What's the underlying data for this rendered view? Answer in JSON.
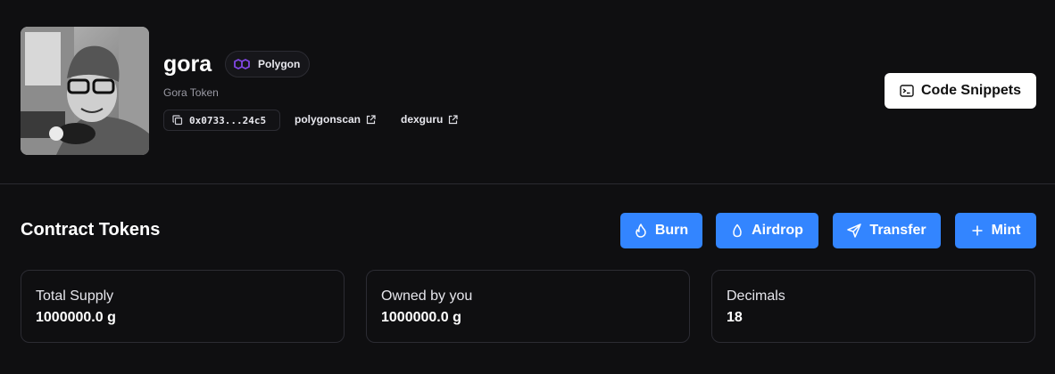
{
  "token": {
    "name": "gora",
    "subtitle": "Gora Token",
    "chain": "Polygon",
    "address_short": "0x0733...24c5",
    "links": [
      {
        "label": "polygonscan"
      },
      {
        "label": "dexguru"
      }
    ]
  },
  "header": {
    "code_snippets_label": "Code Snippets"
  },
  "section": {
    "title": "Contract Tokens",
    "actions": [
      {
        "label": "Burn",
        "icon": "flame-icon"
      },
      {
        "label": "Airdrop",
        "icon": "droplet-icon"
      },
      {
        "label": "Transfer",
        "icon": "send-icon"
      },
      {
        "label": "Mint",
        "icon": "plus-icon"
      }
    ]
  },
  "stats": [
    {
      "label": "Total Supply",
      "value": "1000000.0 g"
    },
    {
      "label": "Owned by you",
      "value": "1000000.0 g"
    },
    {
      "label": "Decimals",
      "value": "18"
    }
  ],
  "colors": {
    "background": "#0f0f11",
    "accent": "#3385ff",
    "polygon_purple": "#8247e5",
    "border": "#2c2c33"
  }
}
